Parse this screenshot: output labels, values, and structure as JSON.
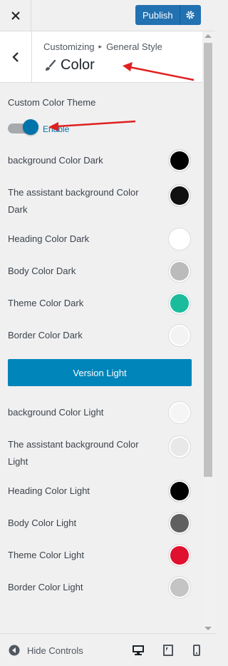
{
  "header": {
    "publish_label": "Publish"
  },
  "section": {
    "breadcrumb_root": "Customizing",
    "breadcrumb_parent": "General Style",
    "title": "Color"
  },
  "toggle": {
    "title": "Custom Color Theme",
    "label": "Enable",
    "enabled": true
  },
  "dark_rows": [
    {
      "label": "background Color Dark",
      "color": "#000000"
    },
    {
      "label": "The assistant background Color Dark",
      "color": "#111111"
    },
    {
      "label": "Heading Color Dark",
      "color": "#ffffff"
    },
    {
      "label": "Body Color Dark",
      "color": "#bbbbbb"
    },
    {
      "label": "Theme Color Dark",
      "color": "#1abc9c"
    },
    {
      "label": "Border Color Dark",
      "color": "#f3f3f3"
    }
  ],
  "version_button": "Version Light",
  "light_rows": [
    {
      "label": "background Color Light",
      "color": "#f5f5f5"
    },
    {
      "label": "The assistant background Color Light",
      "color": "#e8e8e8"
    },
    {
      "label": "Heading Color Light",
      "color": "#000000"
    },
    {
      "label": "Body Color Light",
      "color": "#606060"
    },
    {
      "label": "Theme Color Light",
      "color": "#e0102f"
    },
    {
      "label": "Border Color Light",
      "color": "#c4c4c4"
    }
  ],
  "footer": {
    "hide_controls": "Hide Controls"
  },
  "colors": {
    "accent": "#2271b1",
    "toggle_blue": "#0073aa",
    "annotation_red": "#e02020"
  }
}
